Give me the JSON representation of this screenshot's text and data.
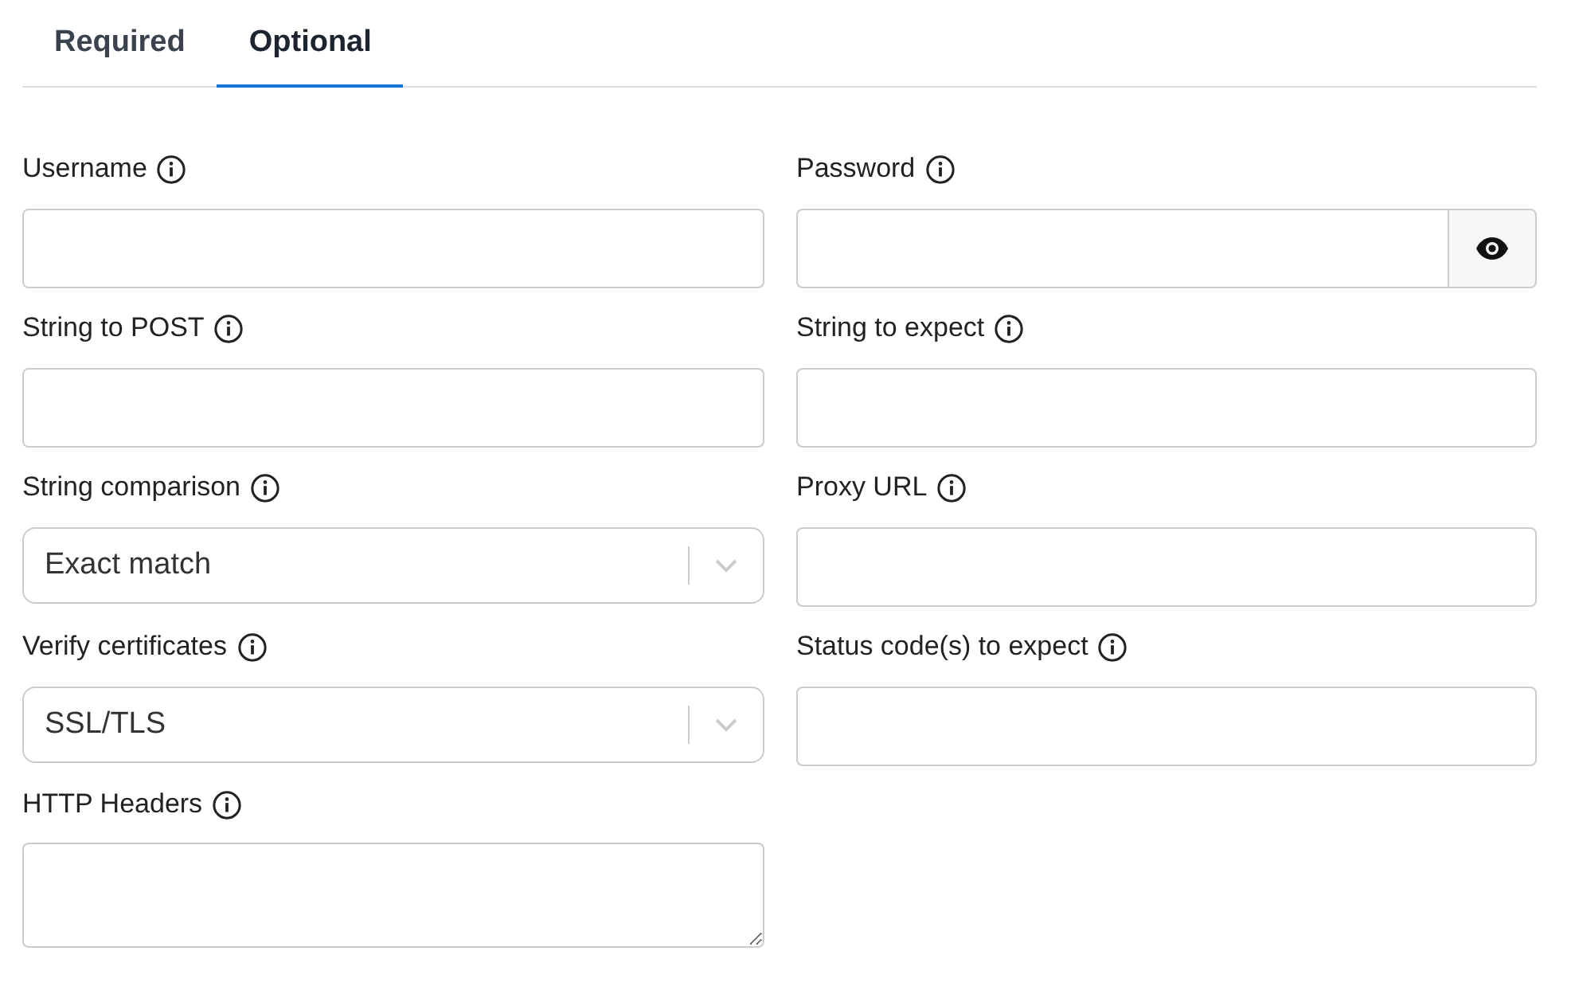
{
  "tabs": [
    {
      "label": "Required",
      "selected": false
    },
    {
      "label": "Optional",
      "selected": true
    }
  ],
  "fields": [
    {
      "label": "Username",
      "kind": "text"
    },
    {
      "label": "Password",
      "kind": "password"
    },
    {
      "label": "String to POST",
      "kind": "text"
    },
    {
      "label": "String to expect",
      "kind": "text"
    },
    {
      "label": "String comparison",
      "kind": "select",
      "value": "Exact match"
    },
    {
      "label": "Proxy URL",
      "kind": "text"
    },
    {
      "label": "Verify certificates",
      "kind": "select",
      "value": "SSL/TLS"
    },
    {
      "label": "Status code(s) to expect",
      "kind": "text"
    },
    {
      "label": "HTTP Headers",
      "kind": "textarea"
    }
  ]
}
